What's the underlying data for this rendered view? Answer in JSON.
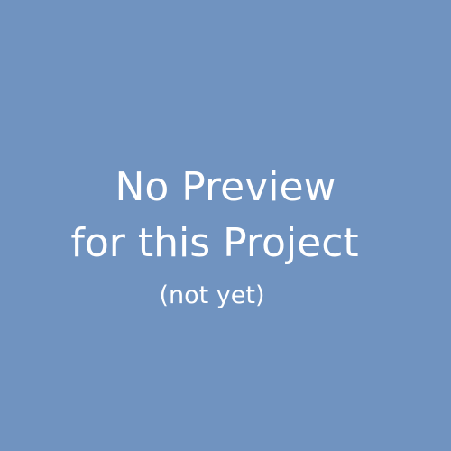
{
  "placeholder": {
    "background_color": "#7093c0",
    "text_color": "#ffffff",
    "line1": "No Preview",
    "line2": "for this Project",
    "line3": "(not yet)"
  }
}
